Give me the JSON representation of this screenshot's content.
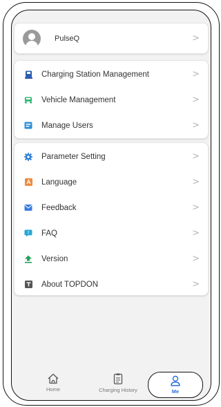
{
  "profile": {
    "name": "PulseQ"
  },
  "management": [
    {
      "label": "Charging Station Management",
      "icon": "charging-station-icon",
      "color": "#2a5db0"
    },
    {
      "label": "Vehicle Management",
      "icon": "car-icon",
      "color": "#2bb673"
    },
    {
      "label": "Manage Users",
      "icon": "users-icon",
      "color": "#2f8fd8"
    }
  ],
  "settings": [
    {
      "label": "Parameter Setting",
      "icon": "gear-icon",
      "color": "#2f7fd6"
    },
    {
      "label": "Language",
      "icon": "language-icon",
      "color": "#f08a3c"
    },
    {
      "label": "Feedback",
      "icon": "feedback-icon",
      "color": "#3a7de0"
    },
    {
      "label": "FAQ",
      "icon": "faq-icon",
      "color": "#27a7d8"
    },
    {
      "label": "Version",
      "icon": "upload-icon",
      "color": "#22a35a"
    },
    {
      "label": "About TOPDON",
      "icon": "info-icon",
      "color": "#555555"
    }
  ],
  "chevron": ">",
  "tabs": {
    "home": "Home",
    "history": "Charging History",
    "me": "Me"
  },
  "colors": {
    "accent": "#2a6fd6"
  }
}
